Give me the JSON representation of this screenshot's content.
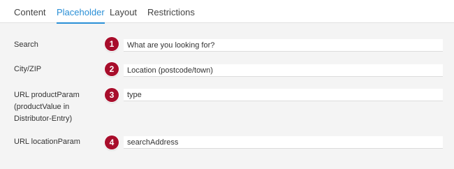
{
  "tabs": [
    {
      "label": "Content",
      "active": false
    },
    {
      "label": "Placeholder",
      "active": true
    },
    {
      "label": "Layout",
      "active": false
    },
    {
      "label": "Restrictions",
      "active": false
    }
  ],
  "accent_color": "#2a8fd6",
  "badge_color": "#a80d2b",
  "rows": [
    {
      "badge": "1",
      "label": "Search",
      "value": "What are you looking for?"
    },
    {
      "badge": "2",
      "label": "City/ZIP",
      "value": "Location (postcode/town)"
    },
    {
      "badge": "3",
      "label": "URL productParam (productValue in Distributor-Entry)",
      "value": "type"
    },
    {
      "badge": "4",
      "label": "URL locationParam",
      "value": "searchAddress"
    }
  ]
}
